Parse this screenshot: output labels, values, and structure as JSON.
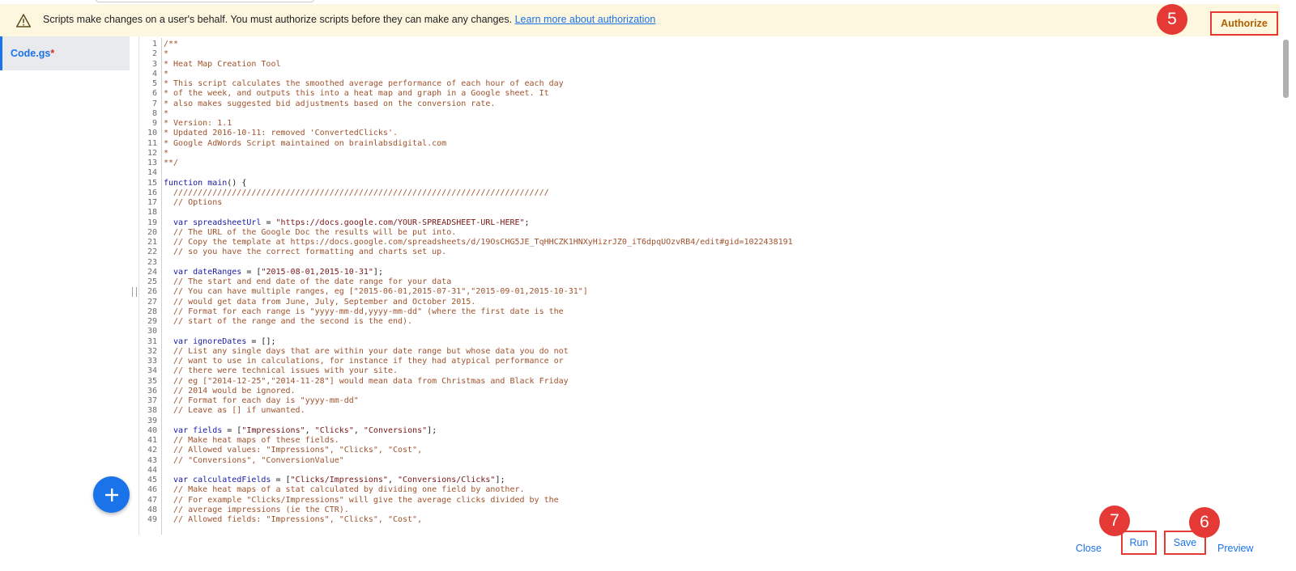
{
  "banner": {
    "message": "Scripts make changes on a user's behalf. You must authorize scripts before they can make any changes.",
    "link_text": "Learn more about authorization",
    "authorize_label": "Authorize",
    "warning_icon": "warning-triangle-icon"
  },
  "sidebar": {
    "file_name": "Code.gs",
    "dirty_marker": "*"
  },
  "steps": {
    "authorize": "5",
    "save": "6",
    "run": "7"
  },
  "bottom_bar": {
    "close_label": "Close",
    "run_label": "Run",
    "save_label": "Save",
    "preview_label": "Preview"
  },
  "fab_icon": "plus-icon",
  "colors": {
    "accent": "#1a73e8",
    "highlight": "#e53935",
    "banner_bg": "#fef7e0",
    "authorize_text": "#b06000"
  },
  "code": [
    {
      "n": "1",
      "t": [
        [
          "c",
          "/**"
        ]
      ]
    },
    {
      "n": "2",
      "t": [
        [
          "c",
          "*"
        ]
      ]
    },
    {
      "n": "3",
      "t": [
        [
          "c",
          "* Heat Map Creation Tool"
        ]
      ]
    },
    {
      "n": "4",
      "t": [
        [
          "c",
          "*"
        ]
      ]
    },
    {
      "n": "5",
      "t": [
        [
          "c",
          "* This script calculates the smoothed average performance of each hour of each day"
        ]
      ]
    },
    {
      "n": "6",
      "t": [
        [
          "c",
          "* of the week, and outputs this into a heat map and graph in a Google sheet. It"
        ]
      ]
    },
    {
      "n": "7",
      "t": [
        [
          "c",
          "* also makes suggested bid adjustments based on the conversion rate."
        ]
      ]
    },
    {
      "n": "8",
      "t": [
        [
          "c",
          "*"
        ]
      ]
    },
    {
      "n": "9",
      "t": [
        [
          "c",
          "* Version: 1.1"
        ]
      ]
    },
    {
      "n": "10",
      "t": [
        [
          "c",
          "* Updated 2016-10-11: removed 'ConvertedClicks'."
        ]
      ]
    },
    {
      "n": "11",
      "t": [
        [
          "c",
          "* Google AdWords Script maintained on brainlabsdigital.com"
        ]
      ]
    },
    {
      "n": "12",
      "t": [
        [
          "c",
          "*"
        ]
      ]
    },
    {
      "n": "13",
      "t": [
        [
          "c",
          "**/"
        ]
      ]
    },
    {
      "n": "14",
      "t": []
    },
    {
      "n": "15",
      "t": [
        [
          "k",
          "function "
        ],
        [
          "v",
          "main"
        ],
        [
          "p",
          "() {"
        ]
      ]
    },
    {
      "n": "16",
      "t": [
        [
          "c",
          "  /////////////////////////////////////////////////////////////////////////////"
        ]
      ]
    },
    {
      "n": "17",
      "t": [
        [
          "c",
          "  // Options"
        ]
      ]
    },
    {
      "n": "18",
      "t": []
    },
    {
      "n": "19",
      "t": [
        [
          "k",
          "  var "
        ],
        [
          "v",
          "spreadsheetUrl"
        ],
        [
          "p",
          " = "
        ],
        [
          "s",
          "\"https://docs.google.com/YOUR-SPREADSHEET-URL-HERE\""
        ],
        [
          "p",
          ";"
        ]
      ]
    },
    {
      "n": "20",
      "t": [
        [
          "c",
          "  // The URL of the Google Doc the results will be put into."
        ]
      ]
    },
    {
      "n": "21",
      "t": [
        [
          "c",
          "  // Copy the template at https://docs.google.com/spreadsheets/d/19OsCHG5JE_TqHHCZK1HNXyHizrJZ0_iT6dpqUOzvRB4/edit#gid=1022438191"
        ]
      ]
    },
    {
      "n": "22",
      "t": [
        [
          "c",
          "  // so you have the correct formatting and charts set up."
        ]
      ]
    },
    {
      "n": "23",
      "t": []
    },
    {
      "n": "24",
      "t": [
        [
          "k",
          "  var "
        ],
        [
          "v",
          "dateRanges"
        ],
        [
          "p",
          " = ["
        ],
        [
          "s",
          "\"2015-08-01,2015-10-31\""
        ],
        [
          "p",
          "];"
        ]
      ]
    },
    {
      "n": "25",
      "t": [
        [
          "c",
          "  // The start and end date of the date range for your data"
        ]
      ]
    },
    {
      "n": "26",
      "t": [
        [
          "c",
          "  // You can have multiple ranges, eg [\"2015-06-01,2015-07-31\",\"2015-09-01,2015-10-31\"]"
        ]
      ]
    },
    {
      "n": "27",
      "t": [
        [
          "c",
          "  // would get data from June, July, September and October 2015."
        ]
      ]
    },
    {
      "n": "28",
      "t": [
        [
          "c",
          "  // Format for each range is \"yyyy-mm-dd,yyyy-mm-dd\" (where the first date is the"
        ]
      ]
    },
    {
      "n": "29",
      "t": [
        [
          "c",
          "  // start of the range and the second is the end)."
        ]
      ]
    },
    {
      "n": "30",
      "t": []
    },
    {
      "n": "31",
      "t": [
        [
          "k",
          "  var "
        ],
        [
          "v",
          "ignoreDates"
        ],
        [
          "p",
          " = [];"
        ]
      ]
    },
    {
      "n": "32",
      "t": [
        [
          "c",
          "  // List any single days that are within your date range but whose data you do not"
        ]
      ]
    },
    {
      "n": "33",
      "t": [
        [
          "c",
          "  // want to use in calculations, for instance if they had atypical performance or"
        ]
      ]
    },
    {
      "n": "34",
      "t": [
        [
          "c",
          "  // there were technical issues with your site."
        ]
      ]
    },
    {
      "n": "35",
      "t": [
        [
          "c",
          "  // eg [\"2014-12-25\",\"2014-11-28\"] would mean data from Christmas and Black Friday"
        ]
      ]
    },
    {
      "n": "36",
      "t": [
        [
          "c",
          "  // 2014 would be ignored."
        ]
      ]
    },
    {
      "n": "37",
      "t": [
        [
          "c",
          "  // Format for each day is \"yyyy-mm-dd\""
        ]
      ]
    },
    {
      "n": "38",
      "t": [
        [
          "c",
          "  // Leave as [] if unwanted."
        ]
      ]
    },
    {
      "n": "39",
      "t": []
    },
    {
      "n": "40",
      "t": [
        [
          "k",
          "  var "
        ],
        [
          "v",
          "fields"
        ],
        [
          "p",
          " = ["
        ],
        [
          "s",
          "\"Impressions\""
        ],
        [
          "p",
          ", "
        ],
        [
          "s",
          "\"Clicks\""
        ],
        [
          "p",
          ", "
        ],
        [
          "s",
          "\"Conversions\""
        ],
        [
          "p",
          "];"
        ]
      ]
    },
    {
      "n": "41",
      "t": [
        [
          "c",
          "  // Make heat maps of these fields."
        ]
      ]
    },
    {
      "n": "42",
      "t": [
        [
          "c",
          "  // Allowed values: \"Impressions\", \"Clicks\", \"Cost\","
        ]
      ]
    },
    {
      "n": "43",
      "t": [
        [
          "c",
          "  // \"Conversions\", \"ConversionValue\""
        ]
      ]
    },
    {
      "n": "44",
      "t": []
    },
    {
      "n": "45",
      "t": [
        [
          "k",
          "  var "
        ],
        [
          "v",
          "calculatedFields"
        ],
        [
          "p",
          " = ["
        ],
        [
          "s",
          "\"Clicks/Impressions\""
        ],
        [
          "p",
          ", "
        ],
        [
          "s",
          "\"Conversions/Clicks\""
        ],
        [
          "p",
          "];"
        ]
      ]
    },
    {
      "n": "46",
      "t": [
        [
          "c",
          "  // Make heat maps of a stat calculated by dividing one field by another."
        ]
      ]
    },
    {
      "n": "47",
      "t": [
        [
          "c",
          "  // For example \"Clicks/Impressions\" will give the average clicks divided by the"
        ]
      ]
    },
    {
      "n": "48",
      "t": [
        [
          "c",
          "  // average impressions (ie the CTR)."
        ]
      ]
    },
    {
      "n": "49",
      "t": [
        [
          "c",
          "  // Allowed fields: \"Impressions\", \"Clicks\", \"Cost\","
        ]
      ]
    }
  ]
}
